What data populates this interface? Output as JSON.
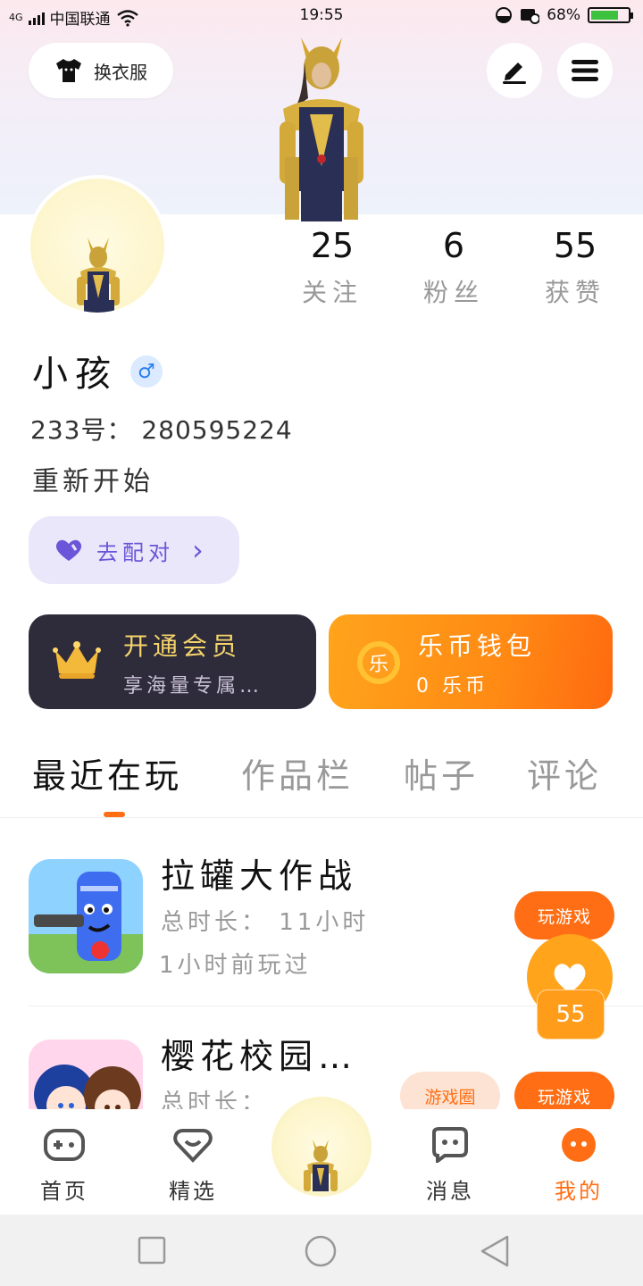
{
  "status_bar": {
    "network": "4G",
    "carrier": "中国联通",
    "time": "19:55",
    "battery": "68%"
  },
  "top": {
    "dress_label": "换衣服"
  },
  "profile": {
    "stats": [
      {
        "value": "25",
        "label": "关注"
      },
      {
        "value": "6",
        "label": "粉丝"
      },
      {
        "value": "55",
        "label": "获赞"
      }
    ],
    "name": "小孩",
    "gender_symbol": "♂",
    "uid": "233号： 280595224",
    "signature": "重新开始",
    "pair_label": "去配对",
    "pair_arrow": "›"
  },
  "cards": {
    "vip_title": "开通会员",
    "vip_sub": "享海量专属…",
    "wallet_title": "乐币钱包",
    "wallet_sub": "0 乐币",
    "wallet_coin": "乐"
  },
  "tabs": [
    "最近在玩",
    "作品栏",
    "帖子",
    "评论"
  ],
  "games": [
    {
      "title": "拉罐大作战",
      "duration": "总时长： 11小时",
      "last_played": "1小时前玩过",
      "play_label": "玩游戏"
    },
    {
      "title": "樱花校园…",
      "duration": "总时长：",
      "circle_label": "游戏圈",
      "play_label": "玩游戏"
    }
  ],
  "float_like_count": "55",
  "bottom_nav": [
    {
      "label": "首页"
    },
    {
      "label": "精选"
    },
    {
      "label": "消息"
    },
    {
      "label": "我的"
    }
  ],
  "colors": {
    "accent": "#ff6e14",
    "vip_gold": "#f5d56a",
    "pair_purple": "#6b55d8"
  }
}
